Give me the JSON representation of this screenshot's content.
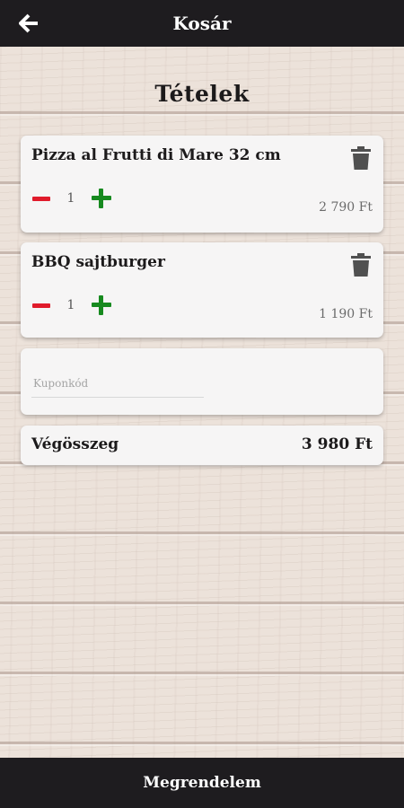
{
  "header": {
    "title": "Kosár",
    "back_icon": "arrow-left-icon"
  },
  "page_title": "Tételek",
  "cart": {
    "items": [
      {
        "name": "Pizza al Frutti di Mare 32 cm",
        "quantity": "1",
        "price": "2 790 Ft"
      },
      {
        "name": "BBQ sajtburger",
        "quantity": "1",
        "price": "1 190 Ft"
      }
    ]
  },
  "coupon": {
    "placeholder": "Kuponkód",
    "value": ""
  },
  "total": {
    "label": "Végösszeg",
    "value": "3 980 Ft"
  },
  "footer": {
    "order_label": "Megrendelem"
  },
  "colors": {
    "bar_background": "#1e1c1f",
    "minus": "#e01b2b",
    "plus": "#178a1f",
    "card": "#f6f5f5"
  }
}
